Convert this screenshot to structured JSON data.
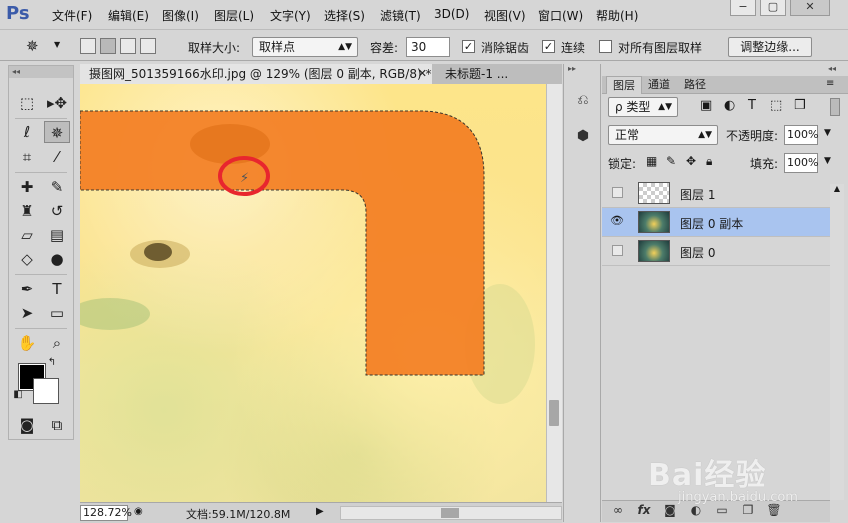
{
  "app": {
    "logo": "Ps"
  },
  "menu": [
    {
      "label": "文件(F)"
    },
    {
      "label": "编辑(E)"
    },
    {
      "label": "图像(I)"
    },
    {
      "label": "图层(L)"
    },
    {
      "label": "文字(Y)"
    },
    {
      "label": "选择(S)"
    },
    {
      "label": "滤镜(T)"
    },
    {
      "label": "3D(D)"
    },
    {
      "label": "视图(V)"
    },
    {
      "label": "窗口(W)"
    },
    {
      "label": "帮助(H)"
    }
  ],
  "window_controls": {
    "minimize": "−",
    "restore": "▢",
    "close": "✕"
  },
  "options": {
    "sample_size_label": "取样大小:",
    "sample_size_value": "取样点",
    "tolerance_label": "容差:",
    "tolerance_value": "30",
    "anti_alias_label": "消除锯齿",
    "anti_alias_checked": true,
    "contiguous_label": "连续",
    "contiguous_checked": true,
    "sample_all_layers_label": "对所有图层取样",
    "sample_all_layers_checked": false,
    "refine_edge_label": "调整边缘..."
  },
  "documents": {
    "tabs": [
      {
        "label": "摄图网_501359166水印.jpg @ 129% (图层 0 副本, RGB/8) *",
        "close": "✕",
        "active": true
      },
      {
        "label": "未标题-1 ...",
        "close": "",
        "active": false
      }
    ]
  },
  "status": {
    "zoom": "128.72%",
    "doc_info": "文档:59.1M/120.8M"
  },
  "layers_panel": {
    "tabs": [
      {
        "label": "图层",
        "active": true
      },
      {
        "label": "通道",
        "active": false
      },
      {
        "label": "路径",
        "active": false
      }
    ],
    "filter_kind": "ρ 类型",
    "blend_mode": "正常",
    "opacity_label": "不透明度:",
    "opacity_value": "100%",
    "lock_label": "锁定:",
    "fill_label": "填充:",
    "fill_value": "100%",
    "layers": [
      {
        "name": "图层 1",
        "visible": false,
        "selected": false,
        "thumb": "transparent"
      },
      {
        "name": "图层 0 副本",
        "visible": true,
        "selected": true,
        "thumb": "photo"
      },
      {
        "name": "图层 0",
        "visible": false,
        "selected": false,
        "thumb": "photo"
      }
    ]
  },
  "watermark": {
    "logo": "Bai经验",
    "url": "jingyan.baidu.com"
  },
  "colors": {
    "selection_fill": "#f47c20",
    "annotation_circle": "#e8262e",
    "selected_layer": "#a9c4ef"
  }
}
